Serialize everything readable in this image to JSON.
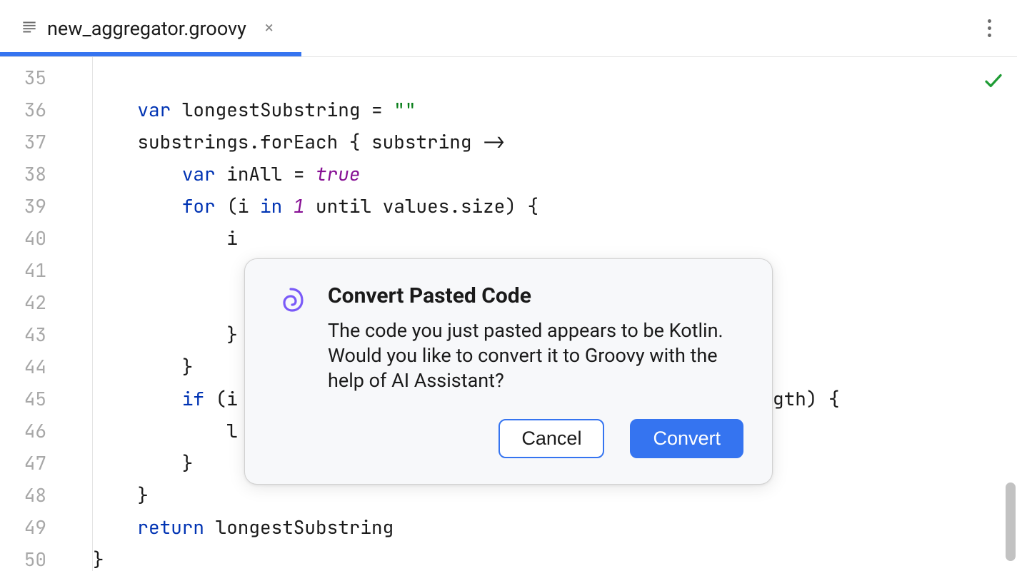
{
  "tab": {
    "filename": "new_aggregator.groovy",
    "close_glyph": "×"
  },
  "gutter": {
    "start": 35,
    "end": 50
  },
  "code": {
    "lines": [
      {
        "n": 35,
        "tokens": []
      },
      {
        "n": 36,
        "tokens": [
          {
            "t": "    ",
            "c": "txt"
          },
          {
            "t": "var ",
            "c": "kw"
          },
          {
            "t": "longestSubstring = ",
            "c": "txt"
          },
          {
            "t": "\"\"",
            "c": "str"
          }
        ]
      },
      {
        "n": 37,
        "tokens": [
          {
            "t": "    substrings.",
            "c": "txt"
          },
          {
            "t": "forEach",
            "c": "fn"
          },
          {
            "t": " { ",
            "c": "txt"
          },
          {
            "t": "substring ->",
            "c": "fn"
          }
        ]
      },
      {
        "n": 38,
        "tokens": [
          {
            "t": "        ",
            "c": "txt"
          },
          {
            "t": "var ",
            "c": "kw"
          },
          {
            "t": "inAll = ",
            "c": "txt"
          },
          {
            "t": "true",
            "c": "lit"
          }
        ]
      },
      {
        "n": 39,
        "tokens": [
          {
            "t": "        ",
            "c": "txt"
          },
          {
            "t": "for ",
            "c": "kw"
          },
          {
            "t": "(i ",
            "c": "txt"
          },
          {
            "t": "in ",
            "c": "kw"
          },
          {
            "t": "1 ",
            "c": "lit"
          },
          {
            "t": "until",
            "c": "fn"
          },
          {
            "t": " values.size) {",
            "c": "txt"
          }
        ]
      },
      {
        "n": 40,
        "tokens": [
          {
            "t": "            i",
            "c": "txt"
          }
        ]
      },
      {
        "n": 41,
        "tokens": []
      },
      {
        "n": 42,
        "tokens": []
      },
      {
        "n": 43,
        "tokens": [
          {
            "t": "            }",
            "c": "txt"
          }
        ]
      },
      {
        "n": 44,
        "tokens": [
          {
            "t": "        }",
            "c": "txt"
          }
        ]
      },
      {
        "n": 45,
        "tokens": [
          {
            "t": "        ",
            "c": "txt"
          },
          {
            "t": "if ",
            "c": "kw"
          },
          {
            "t": "(i",
            "c": "txt"
          }
        ],
        "tail": "gth) {"
      },
      {
        "n": 46,
        "tokens": [
          {
            "t": "            l",
            "c": "txt"
          }
        ]
      },
      {
        "n": 47,
        "tokens": [
          {
            "t": "        }",
            "c": "txt"
          }
        ]
      },
      {
        "n": 48,
        "tokens": [
          {
            "t": "    }",
            "c": "txt"
          }
        ]
      },
      {
        "n": 49,
        "tokens": [
          {
            "t": "    ",
            "c": "txt"
          },
          {
            "t": "return ",
            "c": "kw"
          },
          {
            "t": "longestSubstring",
            "c": "txt"
          }
        ]
      },
      {
        "n": 50,
        "tokens": [
          {
            "t": "}",
            "c": "txt"
          }
        ]
      }
    ]
  },
  "dialog": {
    "title": "Convert Pasted Code",
    "body": "The code you just pasted appears to be Kotlin. Would you like to convert it to Groovy with the help of AI Assistant?",
    "cancel": "Cancel",
    "convert": "Convert"
  }
}
